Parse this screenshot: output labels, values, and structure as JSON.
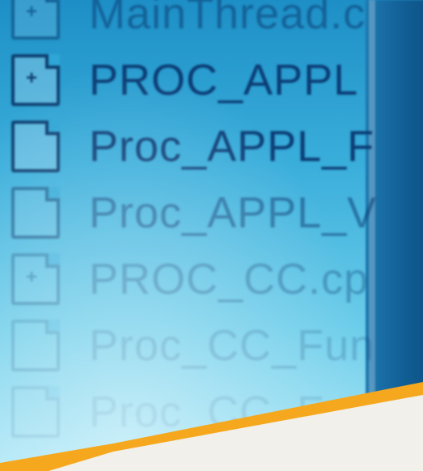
{
  "file_list": {
    "items": [
      {
        "name": "MainThread.c",
        "icon": "c-source-file-icon"
      },
      {
        "name": "PROC_APPL",
        "icon": "c-source-file-icon"
      },
      {
        "name": "Proc_APPL_F",
        "icon": "header-file-icon"
      },
      {
        "name": "Proc_APPL_V",
        "icon": "header-file-icon"
      },
      {
        "name": "PROC_CC.cp",
        "icon": "c-source-file-icon"
      },
      {
        "name": "Proc_CC_Fun",
        "icon": "header-file-icon"
      },
      {
        "name": "Proc_CC_F",
        "icon": "header-file-icon"
      }
    ]
  },
  "colors": {
    "screen_blue": "#2fa6d6",
    "text_dark_blue": "#0b3c74",
    "paper_orange": "#f5a81e",
    "paper_white": "#f1f0eb"
  }
}
